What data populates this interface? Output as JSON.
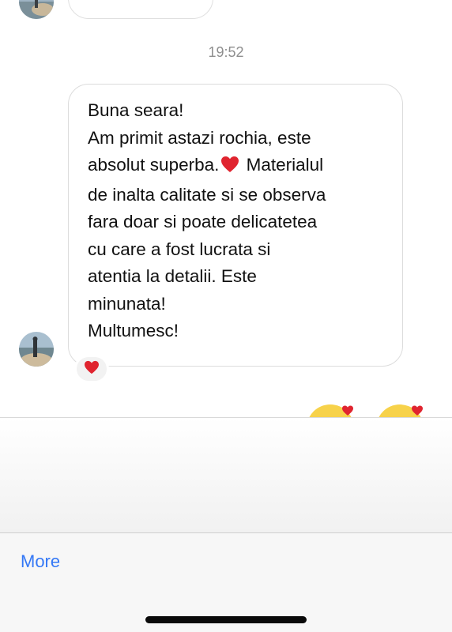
{
  "chat": {
    "timestamp": "19:52",
    "message": {
      "lines": [
        "Buna seara!",
        "Am primit astazi rochia, este",
        "absolut superba.",
        " Materialul",
        "de inalta calitate si se observa",
        "fara doar si poate delicatetea",
        "cu care a fost lucrata si",
        "atentia la detalii. Este",
        "minunata!",
        "Multumesc!"
      ],
      "inline_emoji": "red-heart-icon",
      "reaction": "red-heart-icon"
    }
  },
  "action_sheet": {
    "more_label": "More"
  },
  "colors": {
    "link_blue": "#3478f6",
    "heart_red": "#e0242f",
    "timestamp_gray": "#8e8e8e",
    "bubble_border": "#dcdcdc"
  }
}
